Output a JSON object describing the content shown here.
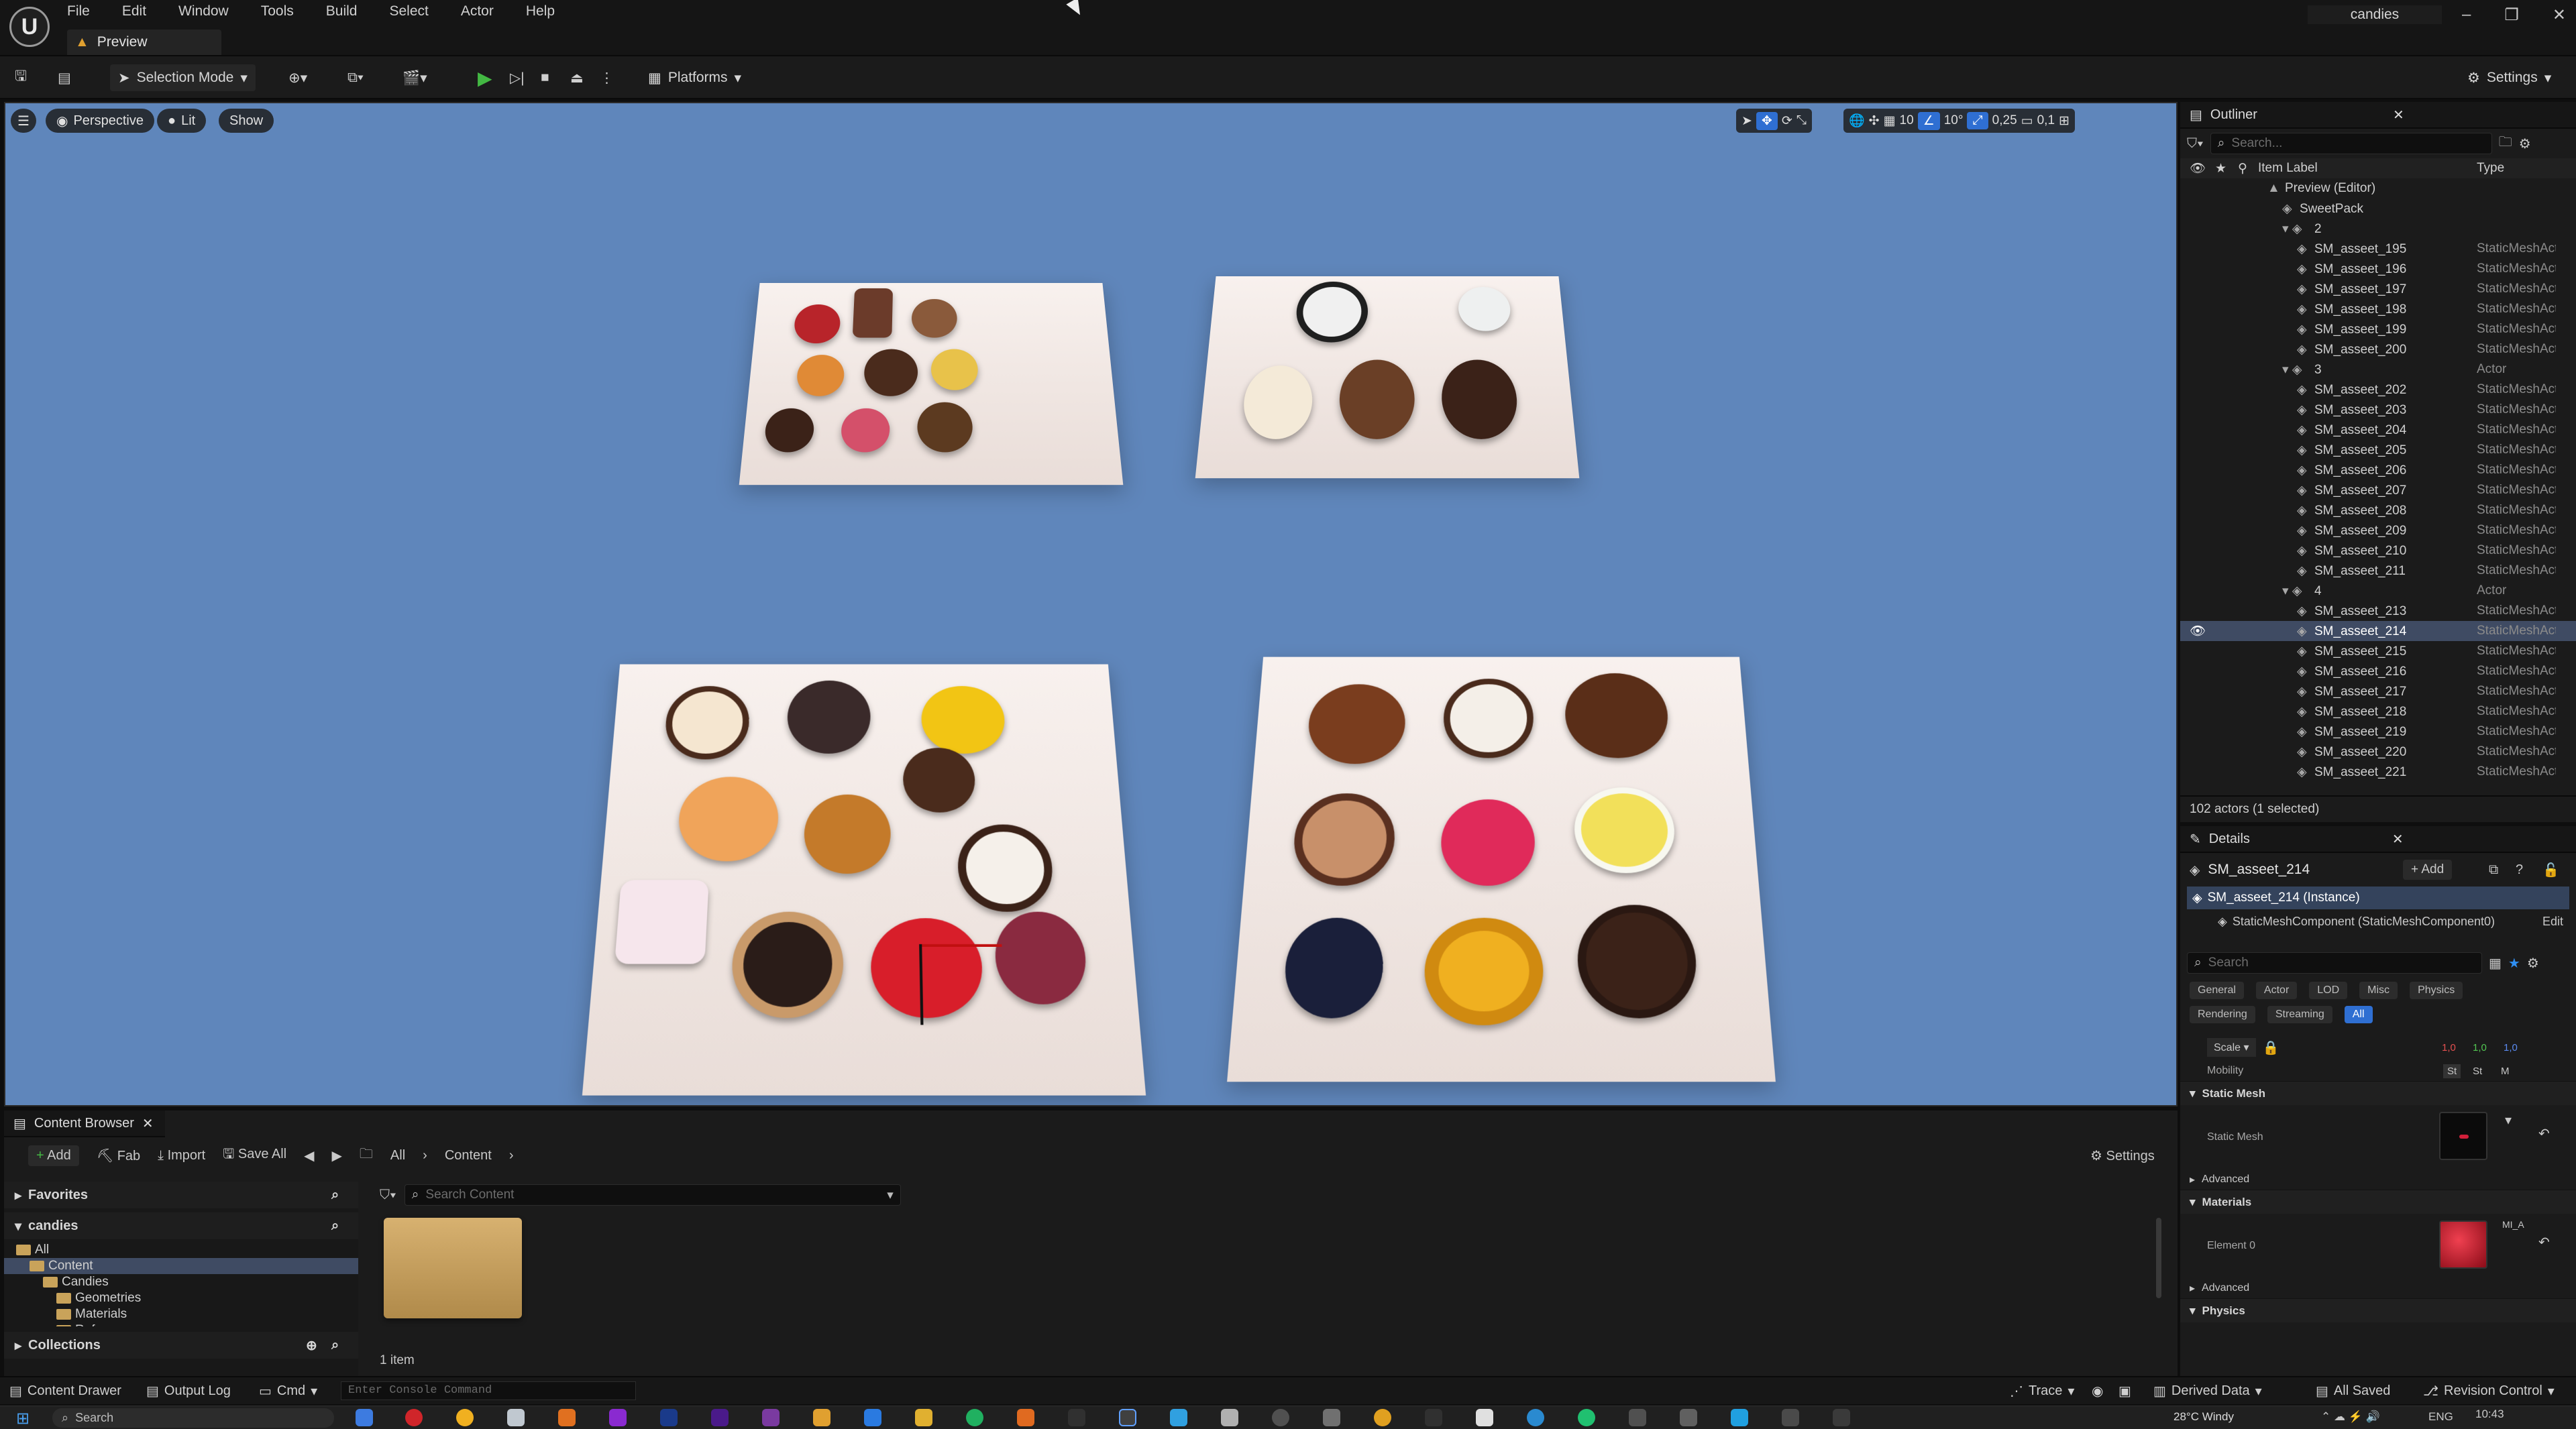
{
  "app": {
    "logo": "U",
    "menu": [
      "File",
      "Edit",
      "Window",
      "Tools",
      "Build",
      "Select",
      "Actor",
      "Help"
    ],
    "doc_tab": "Preview",
    "project_name": "candies",
    "window_controls": [
      "–",
      "❐",
      "✕"
    ]
  },
  "toolbar": {
    "selection_mode": "Selection Mode",
    "platforms": "Platforms",
    "settings": "Settings"
  },
  "viewport": {
    "perspective": "Perspective",
    "lit": "Lit",
    "show": "Show",
    "grid_snap": "10",
    "rotation_snap": "10°",
    "scale_snap": "0,25",
    "camera_speed": "0,1"
  },
  "outliner": {
    "title": "Outliner",
    "search_placeholder": "Search...",
    "col_label": "Item Label",
    "col_type": "Type",
    "rows": [
      {
        "label": "Preview (Editor)",
        "type": "",
        "indent": 0
      },
      {
        "label": "SweetPack",
        "type": "",
        "indent": 1
      },
      {
        "label": "2",
        "type": "",
        "indent": 1
      },
      {
        "label": "SM_asseet_195",
        "type": "StaticMeshActor",
        "indent": 2
      },
      {
        "label": "SM_asseet_196",
        "type": "StaticMeshActor",
        "indent": 2
      },
      {
        "label": "SM_asseet_197",
        "type": "StaticMeshActor",
        "indent": 2
      },
      {
        "label": "SM_asseet_198",
        "type": "StaticMeshActor",
        "indent": 2
      },
      {
        "label": "SM_asseet_199",
        "type": "StaticMeshActor",
        "indent": 2
      },
      {
        "label": "SM_asseet_200",
        "type": "StaticMeshActor",
        "indent": 2
      },
      {
        "label": "3",
        "type": "Actor",
        "indent": 1
      },
      {
        "label": "SM_asseet_202",
        "type": "StaticMeshActor",
        "indent": 2
      },
      {
        "label": "SM_asseet_203",
        "type": "StaticMeshActor",
        "indent": 2
      },
      {
        "label": "SM_asseet_204",
        "type": "StaticMeshActor",
        "indent": 2
      },
      {
        "label": "SM_asseet_205",
        "type": "StaticMeshActor",
        "indent": 2
      },
      {
        "label": "SM_asseet_206",
        "type": "StaticMeshActor",
        "indent": 2
      },
      {
        "label": "SM_asseet_207",
        "type": "StaticMeshActor",
        "indent": 2
      },
      {
        "label": "SM_asseet_208",
        "type": "StaticMeshActor",
        "indent": 2
      },
      {
        "label": "SM_asseet_209",
        "type": "StaticMeshActor",
        "indent": 2
      },
      {
        "label": "SM_asseet_210",
        "type": "StaticMeshActor",
        "indent": 2
      },
      {
        "label": "SM_asseet_211",
        "type": "StaticMeshActor",
        "indent": 2
      },
      {
        "label": "4",
        "type": "Actor",
        "indent": 1
      },
      {
        "label": "SM_asseet_213",
        "type": "StaticMeshActor",
        "indent": 2
      },
      {
        "label": "SM_asseet_214",
        "type": "StaticMeshActor",
        "indent": 2,
        "selected": true
      },
      {
        "label": "SM_asseet_215",
        "type": "StaticMeshActor",
        "indent": 2
      },
      {
        "label": "SM_asseet_216",
        "type": "StaticMeshActor",
        "indent": 2
      },
      {
        "label": "SM_asseet_217",
        "type": "StaticMeshActor",
        "indent": 2
      },
      {
        "label": "SM_asseet_218",
        "type": "StaticMeshActor",
        "indent": 2
      },
      {
        "label": "SM_asseet_219",
        "type": "StaticMeshActor",
        "indent": 2
      },
      {
        "label": "SM_asseet_220",
        "type": "StaticMeshActor",
        "indent": 2
      },
      {
        "label": "SM_asseet_221",
        "type": "StaticMeshActor",
        "indent": 2
      }
    ],
    "footer": "102 actors (1 selected)"
  },
  "details": {
    "title": "Details",
    "actor_name": "SM_asseet_214",
    "add": "+ Add",
    "instance": "SM_asseet_214 (Instance)",
    "component": "StaticMeshComponent (StaticMeshComponent0)",
    "edit": "Edit",
    "search_placeholder": "Search",
    "filters_row1": [
      "General",
      "Actor",
      "LOD",
      "Misc",
      "Physics"
    ],
    "filters_row2": [
      "Rendering",
      "Streaming",
      "All"
    ],
    "scale_label": "Scale",
    "scale_values": [
      "1,0",
      "1,0",
      "1,0"
    ],
    "mobility_label": "Mobility",
    "mobility_values": [
      "St",
      "St",
      "M"
    ],
    "section_static_mesh": "Static Mesh",
    "static_mesh_label": "Static Mesh",
    "advanced": "Advanced",
    "section_materials": "Materials",
    "element0_label": "Element 0",
    "material_name": "MI_A",
    "section_physics": "Physics"
  },
  "content_browser": {
    "title": "Content Browser",
    "add": "Add",
    "fab": "Fab",
    "import": "Import",
    "save_all": "Save All",
    "breadcrumb": [
      "All",
      "Content"
    ],
    "settings": "Settings",
    "favorites": "Favorites",
    "project": "candies",
    "tree": [
      {
        "label": "All",
        "indent": 0
      },
      {
        "label": "Content",
        "indent": 1,
        "selected": true
      },
      {
        "label": "Candies",
        "indent": 2
      },
      {
        "label": "Geometries",
        "indent": 3
      },
      {
        "label": "Materials",
        "indent": 3
      },
      {
        "label": "References",
        "indent": 3
      }
    ],
    "collections": "Collections",
    "search_placeholder": "Search Content",
    "item_count": "1 item"
  },
  "statusbar": {
    "content_drawer": "Content Drawer",
    "output_log": "Output Log",
    "cmd": "Cmd",
    "console_placeholder": "Enter Console Command",
    "trace": "Trace",
    "derived_data": "Derived Data",
    "all_saved": "All Saved",
    "revision_control": "Revision Control"
  },
  "taskbar": {
    "search": "Search",
    "weather": "28°C Windy",
    "lang": "ENG",
    "time": "10:43"
  },
  "colors": {
    "accent": "#2f6fd2",
    "viewport_bg": "#5f86bb",
    "selected_row": "#3f4b63"
  }
}
